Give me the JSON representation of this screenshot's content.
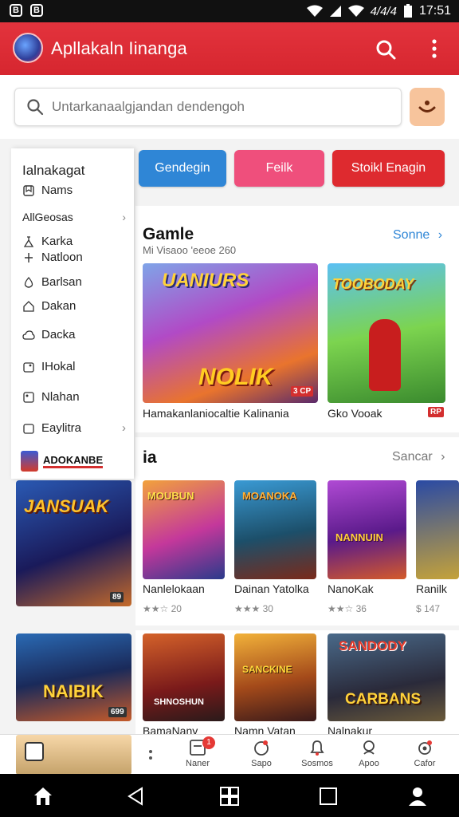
{
  "status_bar": {
    "left_badges": [
      "B",
      "B"
    ],
    "right_text": "4/4/4",
    "time": "17:51"
  },
  "app": {
    "title": "Apllakaln Iinanga"
  },
  "search": {
    "placeholder": "Untarkanaalgjandan dendengoh"
  },
  "chips": [
    {
      "label": "Gendegin",
      "color": "#2f86d6"
    },
    {
      "label": "Feilk",
      "color": "#ef4f7c"
    },
    {
      "label": "Stoikl Enagin",
      "color": "#de2a2f"
    }
  ],
  "drawer": {
    "header": "Ialnakagat",
    "items": [
      {
        "label": "Nams",
        "icon": "bookmark-icon"
      },
      {
        "label": "AllGeosas",
        "icon": "chevron-right-icon",
        "chevron": true
      },
      {
        "label": "Karka",
        "icon": "flask-icon"
      },
      {
        "label": "Natloon",
        "icon": "plus-icon"
      },
      {
        "label": "Barlsan",
        "icon": "drop-icon"
      },
      {
        "label": "Dakan",
        "icon": "home-icon"
      },
      {
        "label": "Dacka",
        "icon": "cloud-icon"
      },
      {
        "label": "IHokal",
        "icon": "tag-icon"
      },
      {
        "label": "Nlahan",
        "icon": "image-icon"
      },
      {
        "label": "Eaylitra",
        "icon": "chevron-right-icon",
        "chevron": true
      }
    ],
    "promo_text": "ADOKANBE"
  },
  "section1": {
    "title": "Gamle",
    "subtitle": "Mi Visaoo 'eeoe 260",
    "link": "Sonne",
    "cards": [
      {
        "title": "Hamakanlaniocaltie Kalinania",
        "art_text": "NOLIK",
        "art_top": "UANIURS",
        "badge": "3 CP"
      },
      {
        "title": "Gko Vooak",
        "art_top": "TOOBODAY",
        "badge": "RP"
      }
    ]
  },
  "section2": {
    "title": "ia",
    "link": "Sancar",
    "cards": [
      {
        "title": "JANSUAK",
        "meta": "",
        "badge": "89"
      },
      {
        "title": "Nanlelokaan",
        "meta": "★★☆  20",
        "art_top": "MOUBUN"
      },
      {
        "title": "Dainan Yatolka",
        "meta": "★★★  30",
        "art_top": "MOANOKA"
      },
      {
        "title": "NanoKak",
        "meta": "★★☆  36",
        "art_top": "NANNUIN"
      },
      {
        "title": "Ranilk",
        "meta": "$ 147"
      }
    ]
  },
  "section3": {
    "cards": [
      {
        "title": "NAIBIK",
        "meta": "",
        "badge": "699"
      },
      {
        "title": "BamaNany",
        "art_top": "SHNOSHUN"
      },
      {
        "title": "Namn Vatan",
        "art_top": "SANCKINE"
      },
      {
        "title": "Nalnakur",
        "art_top": "SANDODY",
        "art_bottom": "CARBANS"
      }
    ]
  },
  "bottom_nav": [
    {
      "label": "Naner",
      "icon": "square-icon",
      "badge": "1"
    },
    {
      "label": "Sapo",
      "icon": "lock-icon"
    },
    {
      "label": "Sosmos",
      "icon": "bell-icon"
    },
    {
      "label": "Apoo",
      "icon": "search-icon"
    },
    {
      "label": "Cafor",
      "icon": "gear-icon"
    }
  ],
  "colors": {
    "primary": "#dc2c34",
    "link": "#2f86d6",
    "accent_orange": "#f7c49c"
  }
}
